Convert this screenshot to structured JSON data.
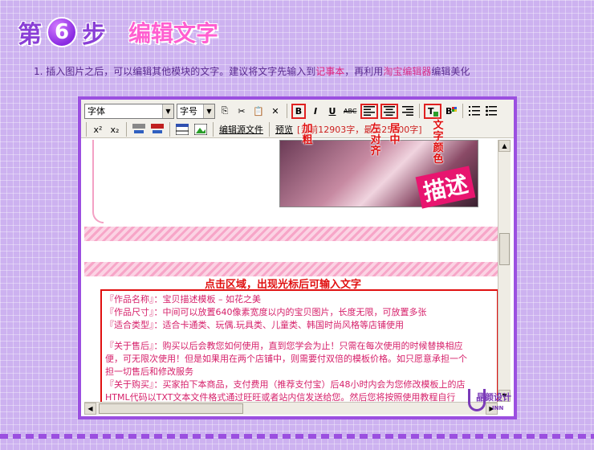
{
  "header": {
    "step_prefix": "第",
    "step_number": "6",
    "step_suffix": "步",
    "title": "编辑文字"
  },
  "instruction": {
    "part1": "1.  插入图片之后，可以编辑其他模块的文字。建议将文字先输入到",
    "link1": "记事本",
    "part2": "，再利用",
    "link2": "淘宝编辑器",
    "part3": "编辑美化"
  },
  "toolbar": {
    "font_select": "字体",
    "size_select": "字号",
    "bold": "B",
    "italic": "I",
    "underline": "U",
    "strike": "ABC",
    "superscript": "x²",
    "subscript": "x₂",
    "edit_source": "编辑源文件",
    "preview": "预览",
    "status": "[当前12903字，最多25000字]"
  },
  "annotations": {
    "bold": "加粗",
    "align_left": "左对齐",
    "align_center": "居中",
    "text_color": "文字颜色"
  },
  "editor": {
    "image_badge": "描述",
    "click_hint": "点击区域，出现光标后可输入文字",
    "lines": [
      "『作品名称』：宝贝描述模板 – 如花之美",
      "『作品尺寸』：中间可以放置640像素宽度以内的宝贝图片，长度无限，可放置多张",
      "『适合类型』：适合卡通类、玩偶.玩具类、儿童类、韩国时尚风格等店铺使用",
      "",
      "『关于售后』：购买以后会教您如何使用，直到您学会为止！只需在每次使用的时候替换相应",
      "便，可无限次使用！但是如果用在两个店铺中，则需要付双倍的模板价格。如只愿意承担一个",
      "担一切售后和修改服务",
      "『关于购买』：买家拍下本商品，支付费用（推荐支付宝）后48小时内会为您修改模板上的店",
      "HTML代码以TXT文本文件格式通过旺旺或者站内信发送给您。然后您将按照使用教程自行"
    ]
  },
  "brand": {
    "text": "晶颜设计",
    "sub": "INN"
  },
  "colors": {
    "frame": "#9b4fe0",
    "annotation": "#e01010",
    "editor_text": "#d6206a",
    "title_pink": "#ff5fd0"
  }
}
